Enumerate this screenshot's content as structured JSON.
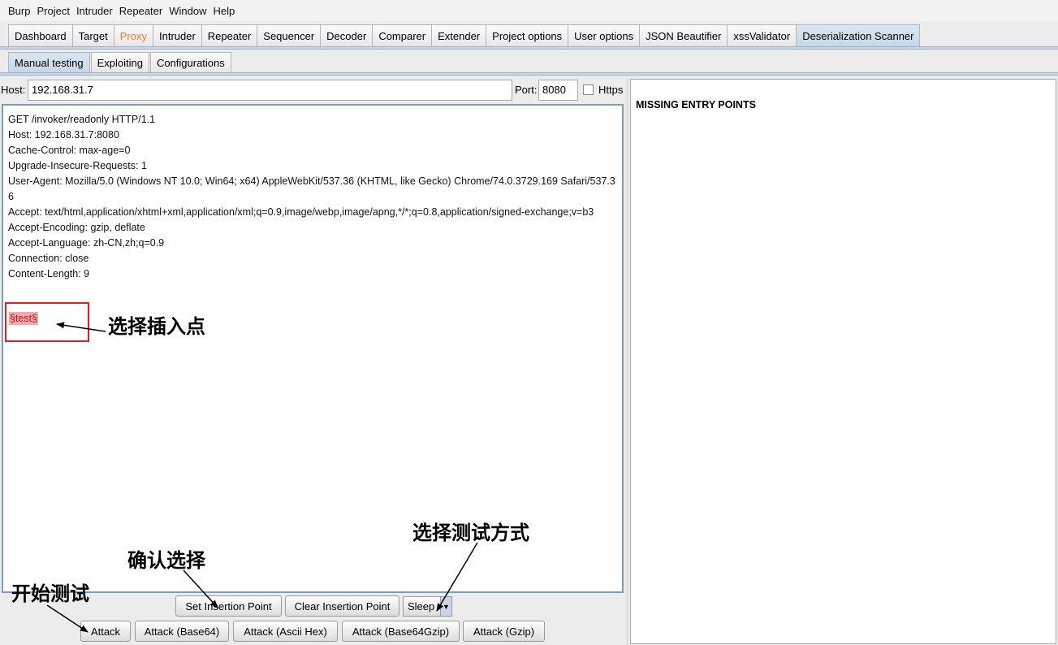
{
  "menu": [
    "Burp",
    "Project",
    "Intruder",
    "Repeater",
    "Window",
    "Help"
  ],
  "main_tabs": [
    "Dashboard",
    "Target",
    "Proxy",
    "Intruder",
    "Repeater",
    "Sequencer",
    "Decoder",
    "Comparer",
    "Extender",
    "Project options",
    "User options",
    "JSON Beautifier",
    "xssValidator",
    "Deserialization Scanner"
  ],
  "sub_tabs": [
    "Manual testing",
    "Exploiting",
    "Configurations"
  ],
  "host": {
    "label": "Host:",
    "value": "192.168.31.7"
  },
  "port": {
    "label": "Port:",
    "value": "8080"
  },
  "https": {
    "label": "Https",
    "checked": false
  },
  "request_text": "GET /invoker/readonly HTTP/1.1\nHost: 192.168.31.7:8080\nCache-Control: max-age=0\nUpgrade-Insecure-Requests: 1\nUser-Agent: Mozilla/5.0 (Windows NT 10.0; Win64; x64) AppleWebKit/537.36 (KHTML, like Gecko) Chrome/74.0.3729.169 Safari/537.36\nAccept: text/html,application/xhtml+xml,application/xml;q=0.9,image/webp,image/apng,*/*;q=0.8,application/signed-exchange;v=b3\nAccept-Encoding: gzip, deflate\nAccept-Language: zh-CN,zh;q=0.9\nConnection: close\nContent-Length: 9",
  "payload": "§test§",
  "results_title": "MISSING ENTRY POINTS",
  "buttons": {
    "set_insertion": "Set Insertion Point",
    "clear_insertion": "Clear Insertion Point",
    "attack": "Attack",
    "attack_base64": "Attack (Base64)",
    "attack_ascii_hex": "Attack (Ascii Hex)",
    "attack_base64gzip": "Attack (Base64Gzip)",
    "attack_gzip": "Attack (Gzip)"
  },
  "test_mode": {
    "value": "Sleep"
  },
  "annotations": {
    "select_insertion": "选择插入点",
    "select_mode": "选择测试方式",
    "confirm": "确认选择",
    "start": "开始测试"
  },
  "colors": {
    "proxy_tab": "#e87a3e",
    "highlight": "#f4aaaa",
    "annotation_box": "#e02020"
  }
}
